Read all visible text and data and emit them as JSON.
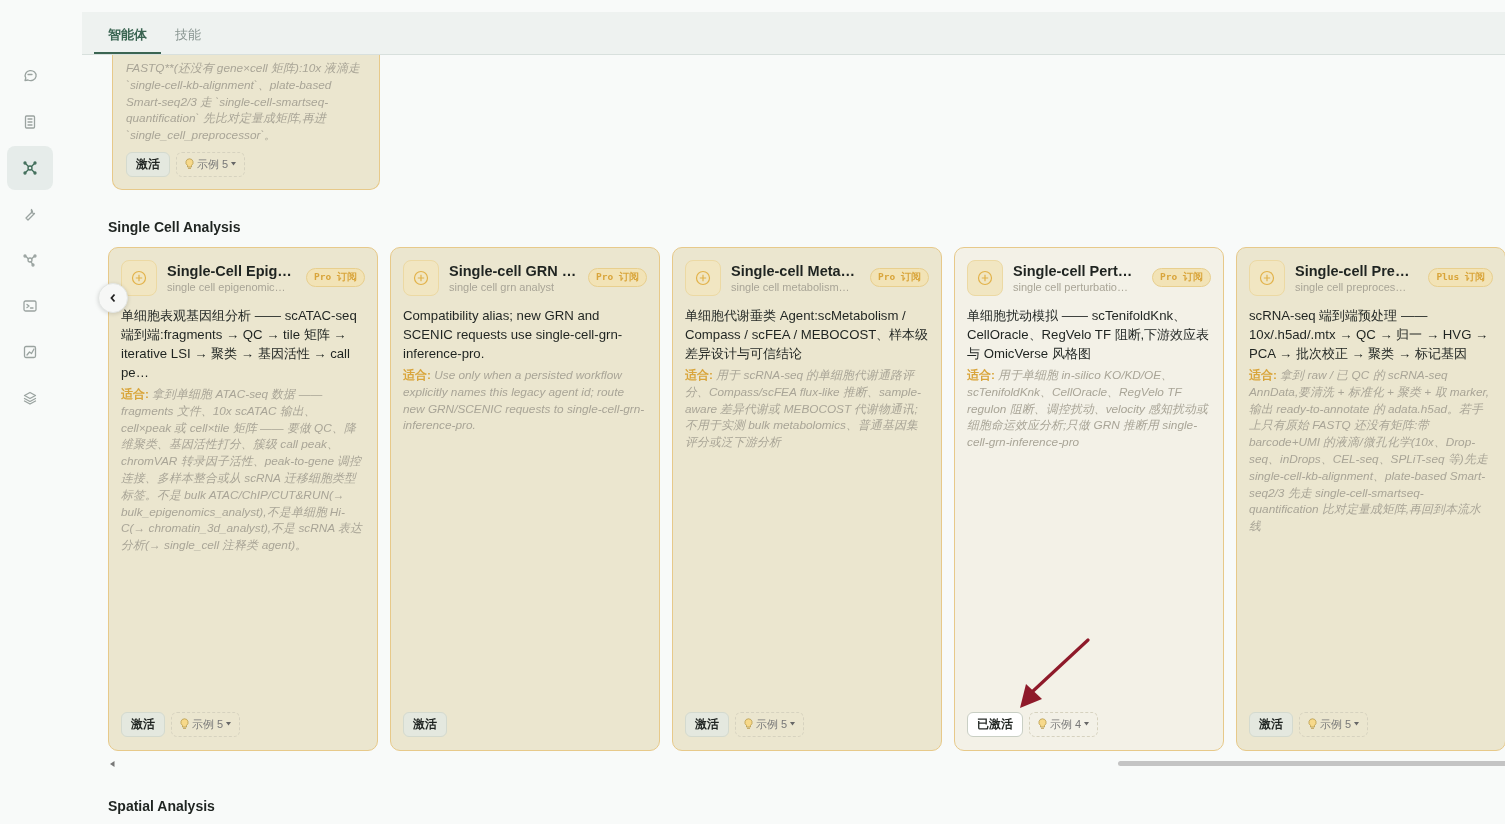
{
  "sidebar": [
    {
      "kind": "chat",
      "selected": false
    },
    {
      "kind": "notebook",
      "selected": false
    },
    {
      "kind": "network",
      "selected": true
    },
    {
      "kind": "wrench",
      "selected": false
    },
    {
      "kind": "nodes",
      "selected": false
    },
    {
      "kind": "terminal",
      "selected": false
    },
    {
      "kind": "chart",
      "selected": false
    },
    {
      "kind": "layers",
      "selected": false
    }
  ],
  "tabs": [
    {
      "label": "智能体",
      "selected": true
    },
    {
      "label": "技能",
      "selected": false
    }
  ],
  "top_card": {
    "body": "FASTQ**(还没有 gene×cell 矩阵):10x 液滴走 `single-cell-kb-alignment`、plate-based Smart-seq2/3 走 `single-cell-smartseq-quantification` 先比对定量成矩阵,再进 `single_cell_preprocessor`。",
    "activate_label": "激活",
    "examples_label": "示例 5"
  },
  "sections": [
    {
      "title": "Single Cell Analysis",
      "cards": [
        {
          "title": "Single-Cell Epig…",
          "subtitle": "single cell epigenomic…",
          "badge": "Pro 订阅",
          "description": "单细胞表观基因组分析 —— scATAC-seq 端到端:fragments → QC → tile 矩阵 → iterative LSI → 聚类 → 基因活性 → call pe…",
          "fit_label": "适合:",
          "fit_text": "拿到单细胞 ATAC-seq 数据 —— fragments 文件、10x scATAC 输出、cell×peak 或 cell×tile 矩阵 —— 要做 QC、降维聚类、基因活性打分、簇级 call peak、chromVAR 转录因子活性、peak-to-gene 调控连接、多样本整合或从 scRNA 迁移细胞类型标签。不是 bulk ATAC/ChIP/CUT&RUN(→ bulk_epigenomics_analyst),不是单细胞 Hi-C(→ chromatin_3d_analyst),不是 scRNA 表达分析(→ single_cell 注释类 agent)。",
          "activated": false,
          "activate_label": "激活",
          "examples_label": "示例 5"
        },
        {
          "title": "Single-cell GRN …",
          "subtitle": "single cell grn analyst",
          "badge": "Pro 订阅",
          "description": "Compatibility alias; new GRN and SCENIC requests use single-cell-grn-inference-pro.",
          "fit_label": "适合:",
          "fit_text": "Use only when a persisted workflow explicitly names this legacy agent id; route new GRN/SCENIC requests to single-cell-grn-inference-pro.",
          "activated": false,
          "activate_label": "激活"
        },
        {
          "title": "Single-cell Meta…",
          "subtitle": "single cell metabolism…",
          "badge": "Pro 订阅",
          "description": "单细胞代谢垂类 Agent:scMetabolism / Compass / scFEA / MEBOCOST、样本级差异设计与可信结论",
          "fit_label": "适合:",
          "fit_text": "用于 scRNA-seq 的单细胞代谢通路评分、Compass/scFEA flux-like 推断、sample-aware 差异代谢或 MEBOCOST 代谢物通讯;不用于实测 bulk metabolomics、普通基因集评分或泛下游分析",
          "activated": false,
          "activate_label": "激活",
          "examples_label": "示例 5"
        },
        {
          "title": "Single-cell Pert…",
          "subtitle": "single cell perturbatio…",
          "badge": "Pro 订阅",
          "description": "单细胞扰动模拟 —— scTenifoldKnk、CellOracle、RegVelo TF 阻断,下游效应表与 OmicVerse 风格图",
          "fit_label": "适合:",
          "fit_text": "用于单细胞 in-silico KO/KD/OE、scTenifoldKnk、CellOracle、RegVelo TF regulon 阻断、调控扰动、velocity 感知扰动或细胞命运效应分析;只做 GRN 推断用 single-cell-grn-inference-pro",
          "activated": true,
          "activate_label": "已激活",
          "examples_label": "示例 4"
        },
        {
          "title": "Single-cell Pre…",
          "subtitle": "single cell preproces…",
          "badge": "Plus 订阅",
          "description": "scRNA-seq 端到端预处理 —— 10x/.h5ad/.mtx → QC → 归一 → HVG → PCA → 批次校正 → 聚类 → 标记基因",
          "fit_label": "适合:",
          "fit_text": "拿到 raw / 已 QC 的 scRNA-seq AnnData,要清洗 + 标准化 + 聚类 + 取 marker,输出 ready-to-annotate 的 adata.h5ad。若手上只有原始 FASTQ 还没有矩阵:带 barcode+UMI 的液滴/微孔化学(10x、Drop-seq、inDrops、CEL-seq、SPLiT-seq 等)先走 single-cell-kb-alignment、plate-based Smart-seq2/3 先走 single-cell-smartseq-quantification 比对定量成矩阵,再回到本流水线",
          "activated": false,
          "activate_label": "激活",
          "examples_label": "示例 5"
        }
      ]
    },
    {
      "title": "Spatial Analysis"
    }
  ]
}
